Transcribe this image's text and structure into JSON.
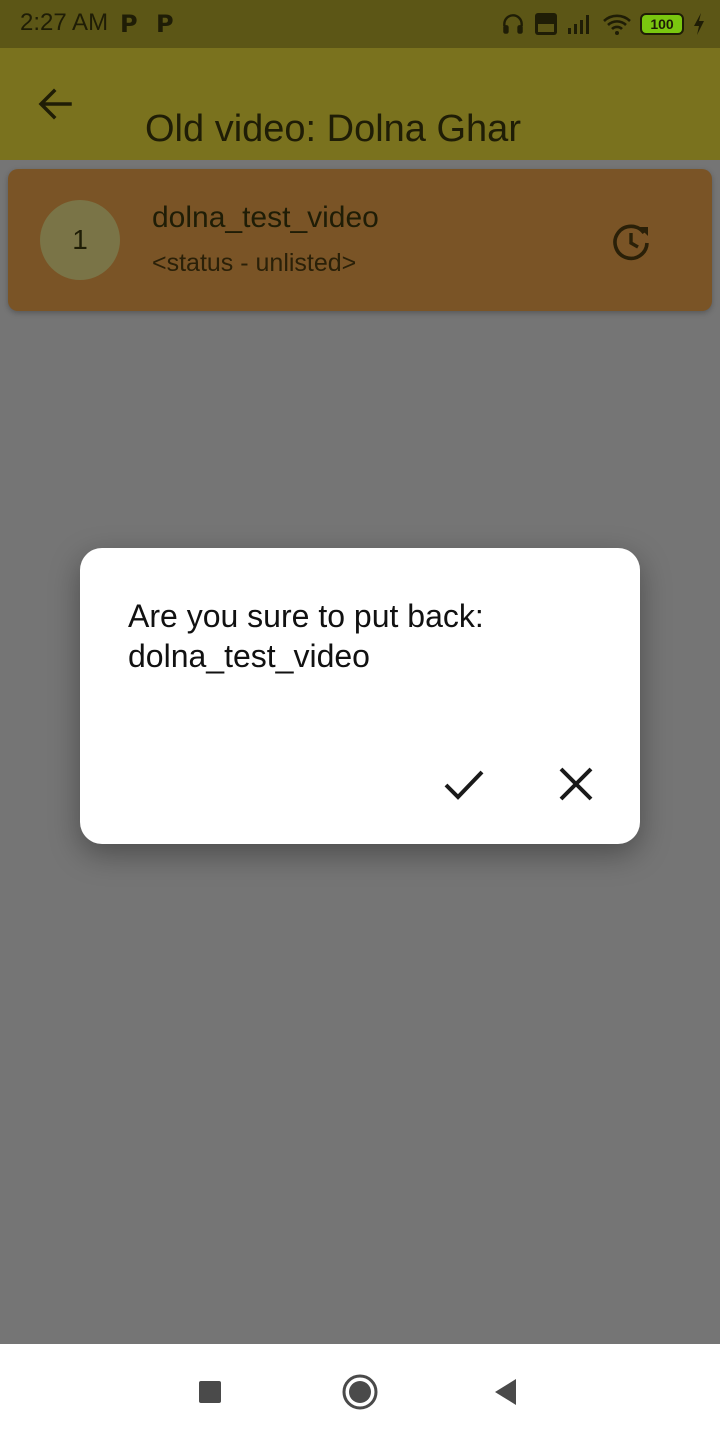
{
  "status_bar": {
    "time": "2:27 AM",
    "notification_icons": [
      "P",
      "P"
    ],
    "battery_level": "100",
    "icons": [
      "headphones-icon",
      "volte-icon",
      "signal-icon",
      "wifi-icon",
      "battery-icon",
      "charging-icon"
    ]
  },
  "app_bar": {
    "title": "Old video: Dolna Ghar",
    "back_icon": "arrow-back-icon"
  },
  "list": {
    "items": [
      {
        "index": "1",
        "title": "dolna_test_video",
        "subtitle": "<status - unlisted>",
        "action_icon": "restore-icon"
      }
    ]
  },
  "dialog": {
    "message": "Are you sure to put back: dolna_test_video",
    "confirm_icon": "check-icon",
    "cancel_icon": "close-icon"
  },
  "nav_bar": {
    "icons": [
      "recents-icon",
      "home-icon",
      "back-icon"
    ]
  },
  "colors": {
    "status_bar": "#5c5616",
    "app_bar": "#7a721e",
    "card": "#7a5426",
    "scrim": "#757575",
    "dialog": "#ffffff"
  }
}
